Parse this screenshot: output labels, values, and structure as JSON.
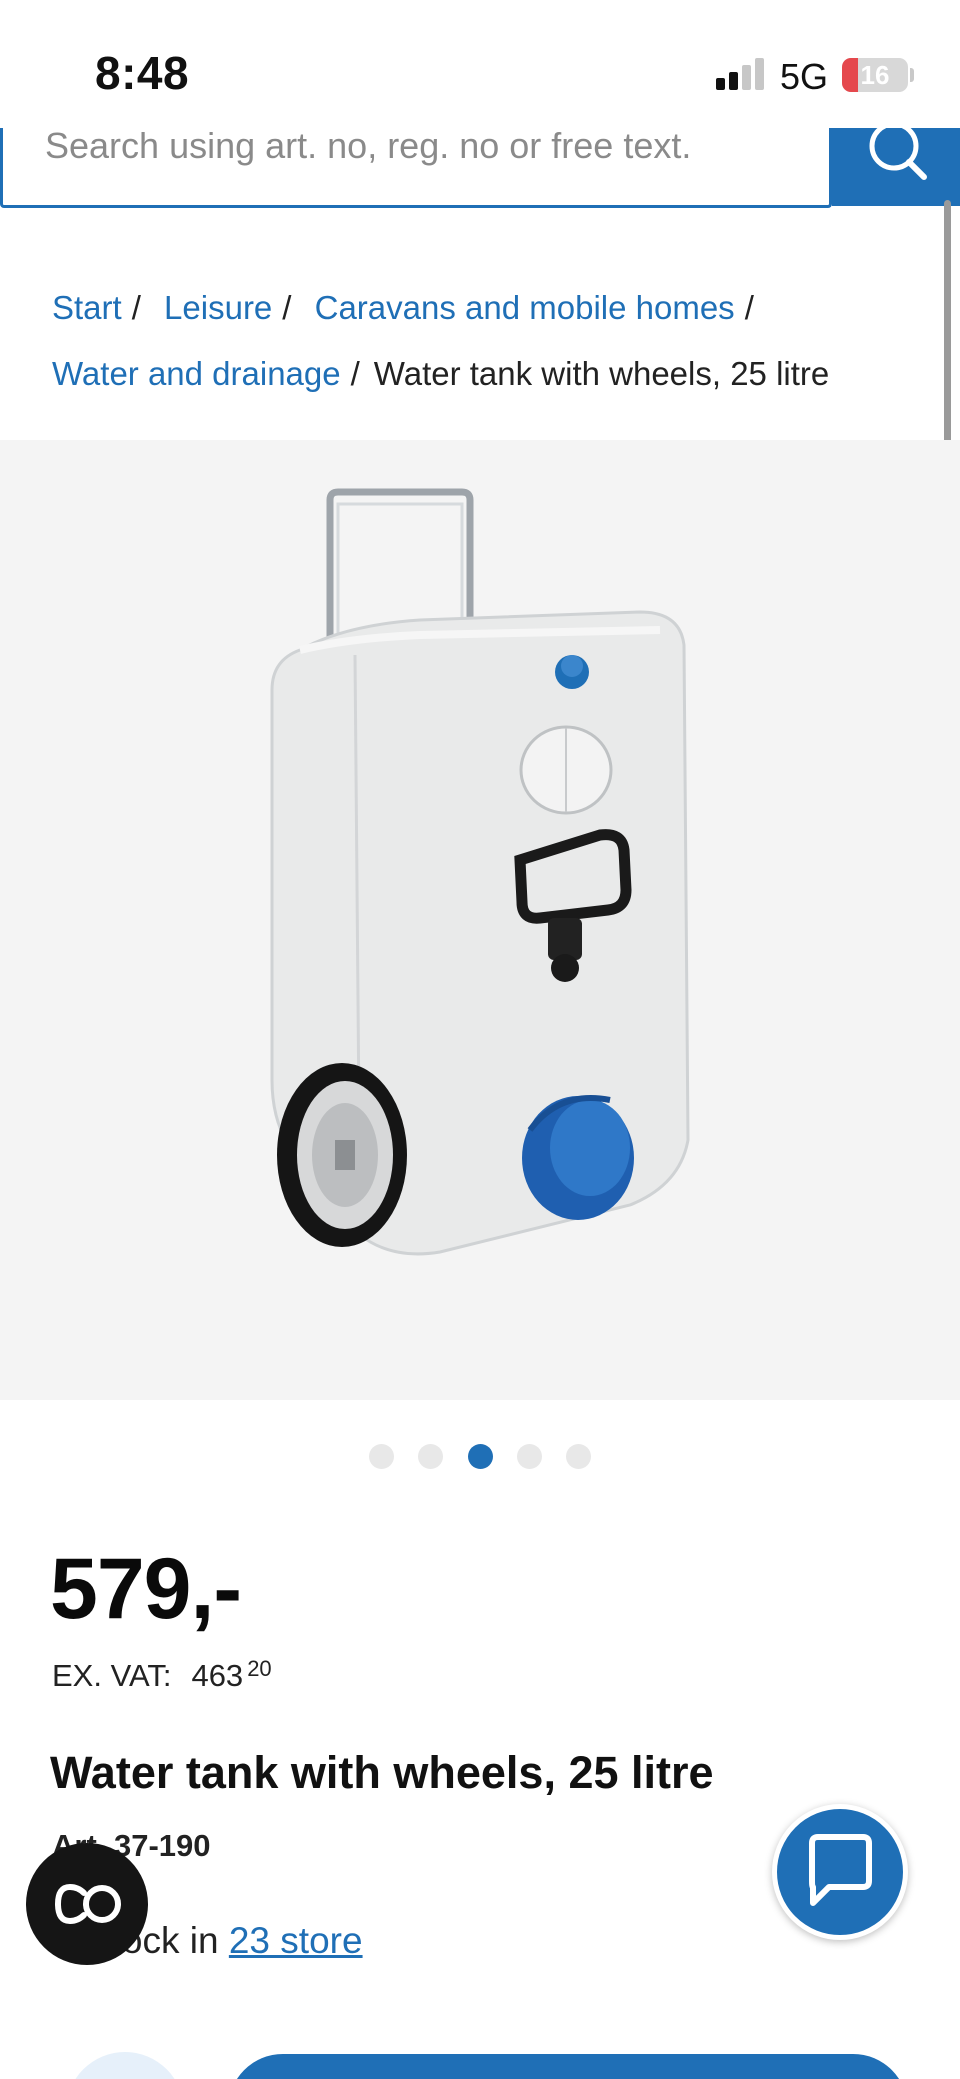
{
  "status_bar": {
    "time": "8:48",
    "network": "5G",
    "battery": "16"
  },
  "search": {
    "placeholder": "Search using art. no, reg. no or free text.",
    "icon": "search-icon"
  },
  "breadcrumb": {
    "items": [
      "Start",
      "Leisure",
      "Caravans and mobile homes",
      "Water and drainage"
    ],
    "separator": "/",
    "current": "Water tank with wheels, 25 litre"
  },
  "gallery": {
    "image_count": 5,
    "active_index": 2
  },
  "product": {
    "price": "579,-",
    "ex_vat_label": "EX. VAT:",
    "ex_vat_whole": "463",
    "ex_vat_fraction": "20",
    "title": "Water tank with wheels, 25 litre",
    "art_no": "Art. 37-190",
    "stock_prefix": "In stock in",
    "stock_link": "23 store"
  },
  "floating": {
    "cookie_icon": "cookie-settings-icon",
    "chat_icon": "chat-icon"
  },
  "colors": {
    "brand_blue": "#1f6fb6",
    "battery_red": "#e5484d"
  }
}
